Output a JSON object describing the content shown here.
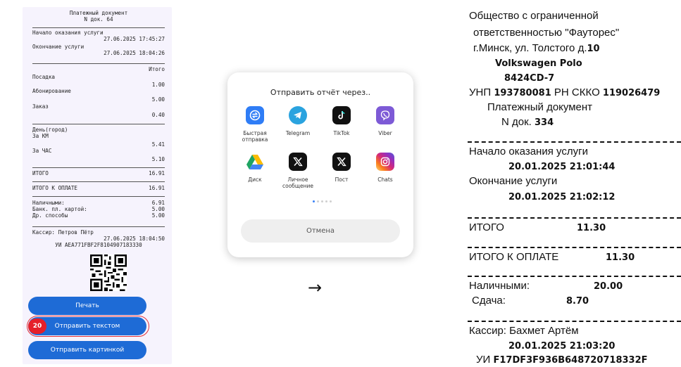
{
  "left_receipt": {
    "title": "Платежный документ",
    "doc_no": "N док. 64",
    "start_label": "Начало оказания услуги",
    "start_time": "27.06.2025 17:45:27",
    "end_label": "Окончание услуги",
    "end_time": "27.06.2025 18:04:26",
    "itogo_header": "Итого",
    "lines": [
      {
        "label": "Посадка",
        "value": "1.00"
      },
      {
        "label": "Абонирование",
        "value": "5.00"
      },
      {
        "label": "Заказ",
        "value": "0.40"
      }
    ],
    "trip_label": "День(город)",
    "km_label": "За КМ",
    "km_value": "5.41",
    "hour_label": "За ЧАС",
    "hour_value": "5.10",
    "total_label": "ИТОГО",
    "total_value": "16.91",
    "topay_label": "ИТОГО К ОПЛАТЕ",
    "topay_value": "16.91",
    "payments": [
      {
        "label": "Наличными:",
        "value": "6.91"
      },
      {
        "label": "Банк. пл. картой:",
        "value": "5.00"
      },
      {
        "label": "Др. способы",
        "value": "5.00"
      }
    ],
    "cashier": "Кассир: Петров Пётр",
    "cashier_time": "27.06.2025 18:04:50",
    "ui_code": "УИ AEA771FBF2F8104907183330"
  },
  "buttons": {
    "print": "Печать",
    "send_text": "Отправить текстом",
    "send_image": "Отправить картинкой",
    "badge": "20"
  },
  "share_sheet": {
    "title": "Отправить отчёт через..",
    "apps": [
      {
        "label": "Быстрая отправка",
        "icon": "quick-share-icon",
        "color": "#2f7df6"
      },
      {
        "label": "Telegram",
        "icon": "telegram-icon",
        "color": "#2aa3df"
      },
      {
        "label": "TikTok",
        "icon": "tiktok-icon",
        "color": "#111111"
      },
      {
        "label": "Viber",
        "icon": "viber-icon",
        "color": "#7d5ad6"
      },
      {
        "label": "Диск",
        "icon": "google-drive-icon",
        "color": "#ffffff"
      },
      {
        "label": "Личное сообщение",
        "icon": "x-icon",
        "color": "#111111"
      },
      {
        "label": "Пост",
        "icon": "x-icon",
        "color": "#111111"
      },
      {
        "label": "Chats",
        "icon": "instagram-icon",
        "color": "#d62976"
      }
    ],
    "cancel": "Отмена",
    "page": "1 of 5"
  },
  "arrow": "→",
  "right_receipt": {
    "company_1": "Общество с ограниченной",
    "company_2": "ответственностью \"Фауторес\"",
    "address_text": "г.Минск, ул. Толстого д.",
    "address_no": "10",
    "car": "Volkswagen Polo",
    "plate": "8424CD-7",
    "unp_label": "УНП",
    "unp": "193780081",
    "rn_label": "РН СККО",
    "rn": "119026479",
    "title": "Платежный документ",
    "doc_label": "N док.",
    "doc_no": "334",
    "start_label": "Начало оказания услуги",
    "start_time": "20.01.2025 21:01:44",
    "end_label": "Окончание услуги",
    "end_time": "20.01.2025 21:02:12",
    "total_label": "ИТОГО",
    "total_value": "11.30",
    "topay_label": "ИТОГО К ОПЛАТЕ",
    "topay_value": "11.30",
    "cash_label": "Наличными:",
    "cash_value": "20.00",
    "change_label": "Сдача:",
    "change_value": "8.70",
    "cashier": "Кассир: Бахмет Артём",
    "cashier_time": "20.01.2025 21:03:20",
    "ui_label": "УИ",
    "ui_code": "F17DF3F936B648720718332F"
  }
}
